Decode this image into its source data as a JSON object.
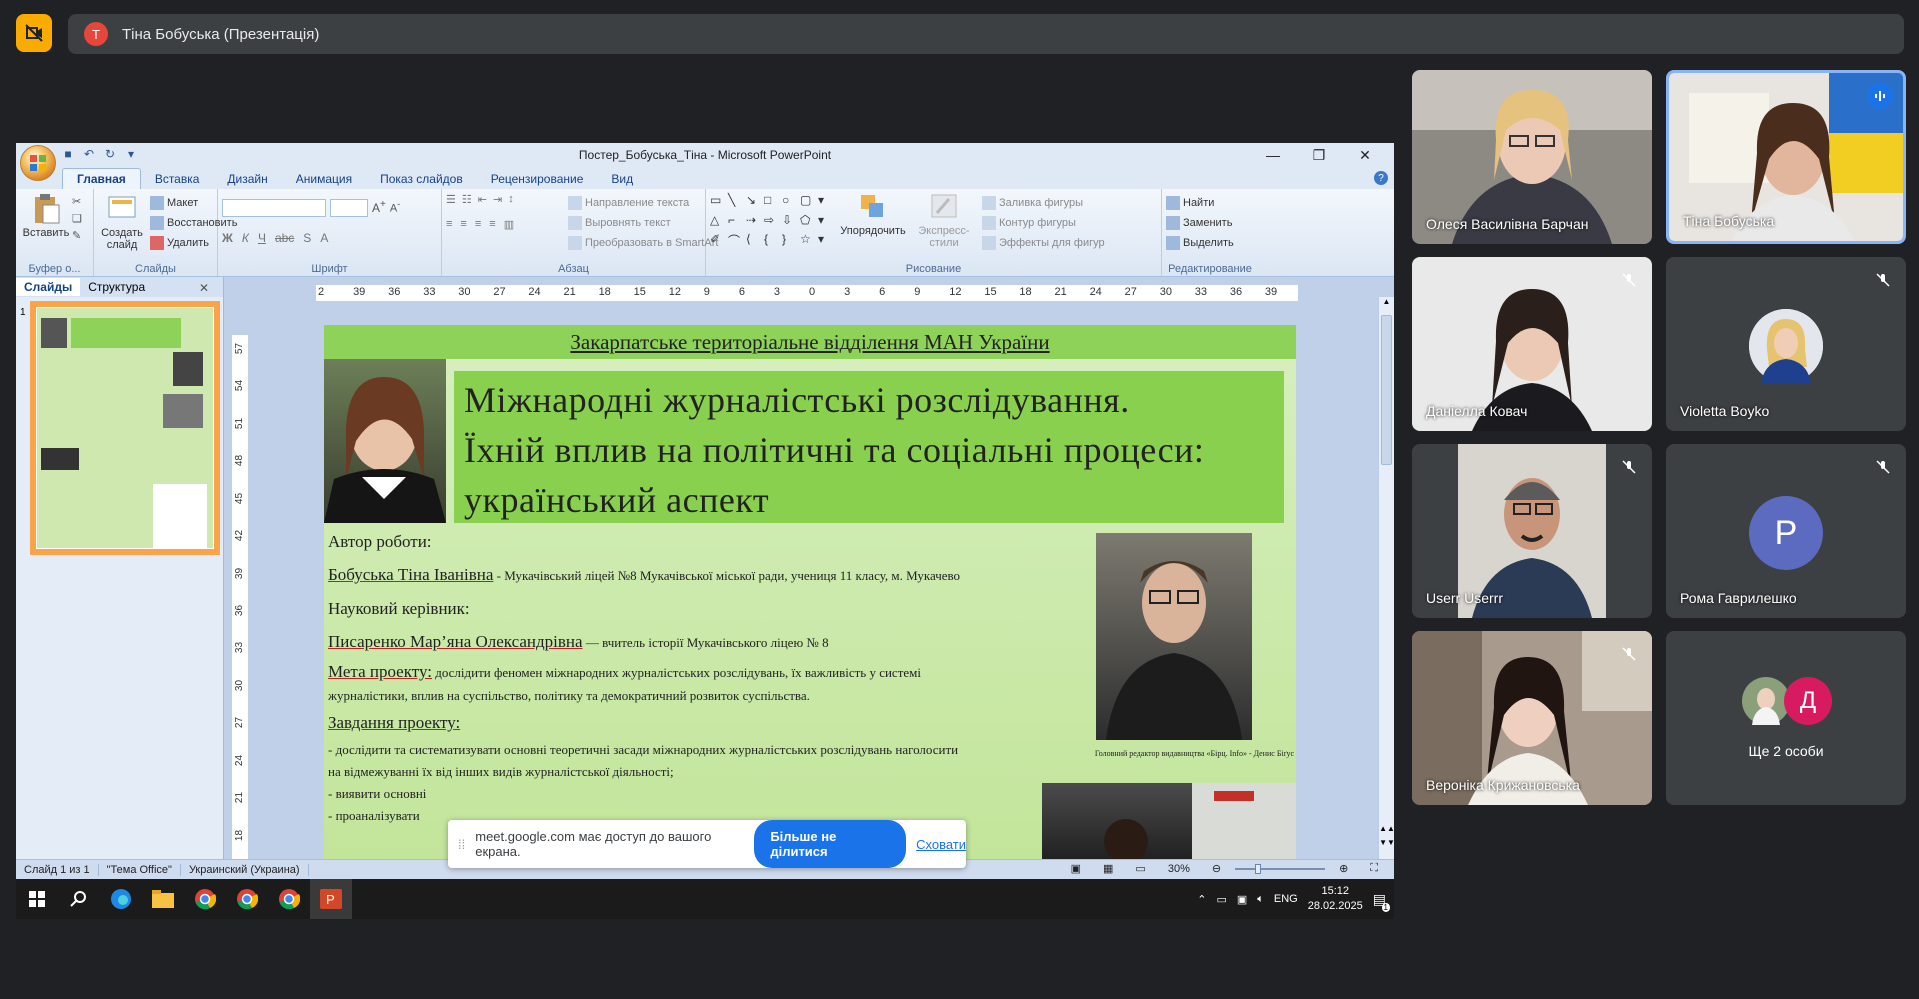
{
  "meet": {
    "presenter_initial": "T",
    "presenter_label": "Тіна Бобуська (Презентація)",
    "share_notice": {
      "text": "meet.google.com має доступ до вашого екрана.",
      "stop_label": "Більше не ділитися",
      "hide_label": "Сховати"
    },
    "participants": [
      {
        "name": "Олеся Василівна Барчан",
        "muted": false
      },
      {
        "name": "Тіна Бобуська",
        "muted": false,
        "speaking": true
      },
      {
        "name": "Даніелла Ковач",
        "muted": true
      },
      {
        "name": "Violetta Boyko",
        "muted": true
      },
      {
        "name": "Userr Userrr",
        "muted": true
      },
      {
        "name": "Рома Гаврилешко",
        "muted": true,
        "initial": "P"
      },
      {
        "name": "Вероніка Крижановська",
        "muted": true
      },
      {
        "name": "Ще 2 особи",
        "initial": "Д"
      }
    ]
  },
  "ppt": {
    "window_title": "Постер_Бобуська_Тіна - Microsoft PowerPoint",
    "tabs": [
      "Главная",
      "Вставка",
      "Дизайн",
      "Анимация",
      "Показ слайдов",
      "Рецензирование",
      "Вид"
    ],
    "ribbon": {
      "clipboard": {
        "paste": "Вставить",
        "label": "Буфер о..."
      },
      "slides": {
        "new_slide": "Создать слайд",
        "layout": "Макет",
        "reset": "Восстановить",
        "delete": "Удалить",
        "label": "Слайды"
      },
      "font": {
        "label": "Шрифт"
      },
      "paragraph": {
        "text_direction": "Направление текста",
        "align_text": "Выровнять текст",
        "smartart": "Преобразовать в SmartArt",
        "label": "Абзац"
      },
      "drawing": {
        "arrange": "Упорядочить",
        "quick_styles": "Экспресс-стили",
        "fill": "Заливка фигуры",
        "outline": "Контур фигуры",
        "effects": "Эффекты для фигур",
        "label": "Рисование"
      },
      "editing": {
        "find": "Найти",
        "replace": "Заменить",
        "select": "Выделить",
        "label": "Редактирование"
      }
    },
    "pane_tabs": {
      "slides": "Слайды",
      "outline": "Структура"
    },
    "thumb_number": "1",
    "hruler": [
      "2",
      "39",
      "36",
      "33",
      "30",
      "27",
      "24",
      "21",
      "18",
      "15",
      "12",
      "9",
      "6",
      "3",
      "0",
      "3",
      "6",
      "9",
      "12",
      "15",
      "18",
      "21",
      "24",
      "27",
      "30",
      "33",
      "36",
      "39"
    ],
    "vruler": [
      "57",
      "54",
      "51",
      "48",
      "45",
      "42",
      "39",
      "36",
      "33",
      "30",
      "27",
      "24",
      "21",
      "18"
    ],
    "slide": {
      "header": "Закарпатське територіальне відділення МАН України",
      "title_l1": "Міжнародні журналістські розслідування.",
      "title_l2": "Їхній вплив на політичні та соціальні процеси:",
      "title_l3": "український аспект",
      "author_label": "Автор роботи:",
      "author_name": "Бобуська Тіна Іванівна",
      "author_info": " - Мукачівський ліцей №8   Мукачівської міської ради, учениця 11 класу, м. Мукачево",
      "supervisor_label": "Науковий керівник:",
      "supervisor_name": "Писаренко Мар’яна Олександрівна",
      "supervisor_info": " — вчитель історії Мукачівського ліцею № 8",
      "goal_label": "Мета проекту:",
      "goal_text_1": " дослідити феномен міжнародних журналістських розслідувань, їх важливість у системі",
      "goal_text_2": "журналістики, вплив на суспільство, політику та демократичний розвиток суспільства.",
      "tasks_label": "Завдання проекту:",
      "task1a": "- дослідити та систематизувати основні теоретичні засади міжнародних журналістських розслідувань наголосити",
      "task1b": "на відмежуванні їх від інших видів журналістської діяльності;",
      "task2": "- виявити основні",
      "task3": "- проаналізувати",
      "caption": "Головний редактор видавництва «Бiрц. Info» - Денис Біґус"
    },
    "status": {
      "slide": "Слайд 1 из 1",
      "theme": "\"Тема Office\"",
      "lang": "Украинский (Украина)",
      "zoom": "30%"
    },
    "taskbar": {
      "lang": "ENG",
      "time": "15:12",
      "date": "28.02.2025",
      "notif": "1"
    }
  }
}
